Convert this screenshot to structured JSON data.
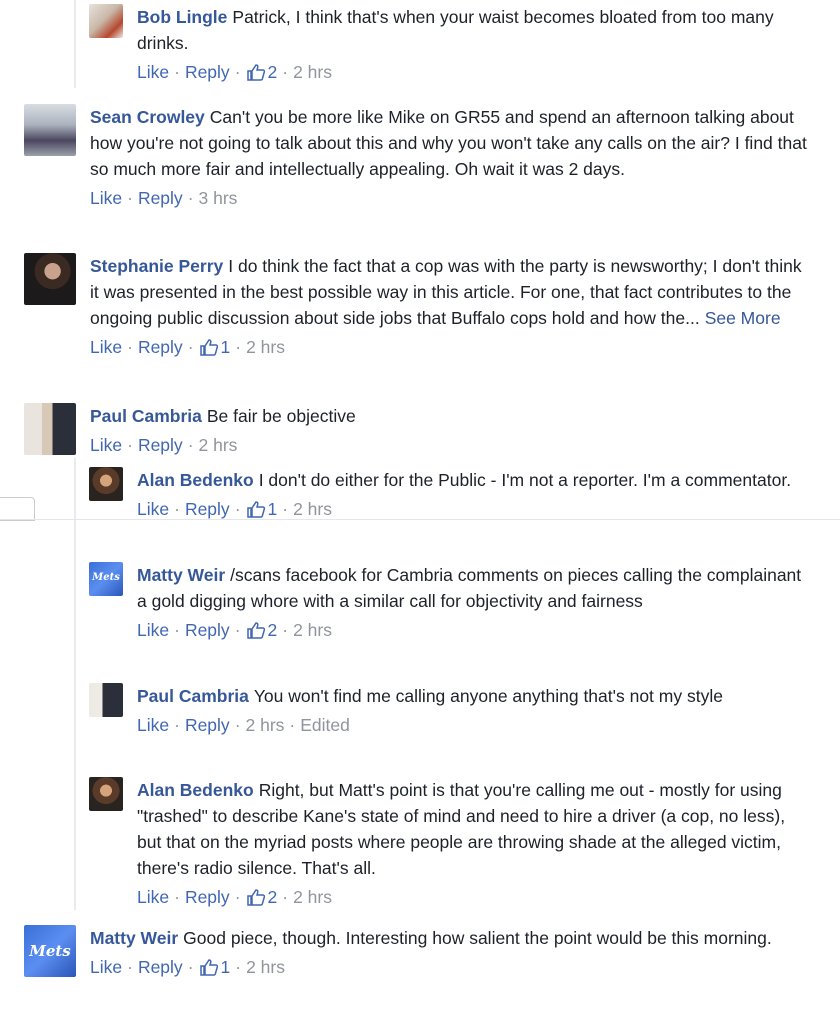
{
  "comments": [
    {
      "author": "Bob Lingle",
      "text": "Patrick, I think that's when your waist becomes bloated from too many drinks.",
      "like": "Like",
      "reply": "Reply",
      "likes": "2",
      "time": "2 hrs",
      "see_more": "",
      "edited": ""
    },
    {
      "author": "Sean Crowley",
      "text": "Can't you be more like Mike on GR55 and spend an afternoon talking about how you're not going to talk about this and why you won't take any calls on the air? I find that so much more fair and intellectually appealing. Oh wait it was 2 days.",
      "like": "Like",
      "reply": "Reply",
      "likes": "",
      "time": "3 hrs",
      "see_more": "",
      "edited": ""
    },
    {
      "author": "Stephanie Perry",
      "text": "I do think the fact that a cop was with the party is newsworthy; I don't think it was presented in the best possible way in this article. For one, that fact contributes to the ongoing public discussion about side jobs that Buffalo cops hold and how the...",
      "like": "Like",
      "reply": "Reply",
      "likes": "1",
      "time": "2 hrs",
      "see_more": "See More",
      "edited": ""
    },
    {
      "author": "Paul Cambria",
      "text": "Be fair be objective",
      "like": "Like",
      "reply": "Reply",
      "likes": "",
      "time": "2 hrs",
      "see_more": "",
      "edited": ""
    },
    {
      "author": "Alan Bedenko",
      "text": "I don't do either for the Public - I'm not a reporter. I'm a commentator.",
      "like": "Like",
      "reply": "Reply",
      "likes": "1",
      "time": "2 hrs",
      "see_more": "",
      "edited": ""
    },
    {
      "author": "Matty Weir",
      "text": "/scans facebook for Cambria comments on pieces calling the complainant a gold digging whore with a similar call for objectivity and fairness",
      "like": "Like",
      "reply": "Reply",
      "likes": "2",
      "time": "2 hrs",
      "see_more": "",
      "edited": ""
    },
    {
      "author": "Paul Cambria",
      "text": "You won't find me calling anyone anything that's not my style",
      "like": "Like",
      "reply": "Reply",
      "likes": "",
      "time": "2 hrs",
      "see_more": "",
      "edited": "Edited"
    },
    {
      "author": "Alan Bedenko",
      "text": "Right, but Matt's point is that you're calling me out - mostly for using \"trashed\" to describe Kane's state of mind and need to hire a driver (a cop, no less), but that on the myriad posts where people are throwing shade at the alleged victim, there's radio silence. That's all.",
      "like": "Like",
      "reply": "Reply",
      "likes": "2",
      "time": "2 hrs",
      "see_more": "",
      "edited": ""
    },
    {
      "author": "Matty Weir",
      "text": "Good piece, though. Interesting how salient the point would be this morning.",
      "like": "Like",
      "reply": "Reply",
      "likes": "1",
      "time": "2 hrs",
      "see_more": "",
      "edited": ""
    }
  ],
  "avatars": {
    "matty_logo_text": "Mets"
  },
  "colors": {
    "author": "#365899",
    "link": "#4267b2",
    "meta": "#90949c",
    "text": "#1d2129"
  },
  "icons": {
    "like": "thumbs-up-icon"
  }
}
